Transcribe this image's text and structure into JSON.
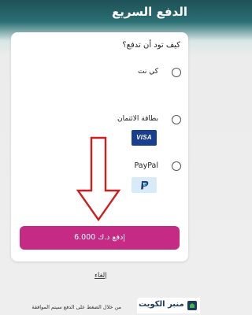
{
  "header": {
    "title": "الدفع السريع"
  },
  "payment": {
    "question": "كيف تود أن تدفع؟",
    "options": [
      {
        "label": "كي نت",
        "selected": false
      },
      {
        "label": "بطاقة الائتمان",
        "selected": false,
        "logo_icon": "visa-logo",
        "logo_text": "VISA"
      },
      {
        "label": "PayPal",
        "selected": false,
        "logo_icon": "paypal-logo"
      }
    ],
    "pay_button_label": "إدفع د.ك 6.000"
  },
  "cancel_label": "إلغاء",
  "footer": {
    "note": "من خلال الضغط على الدفع سيتم الموافقة",
    "brand": "منبر الكويت"
  },
  "colors": {
    "accent": "#c52a85",
    "header": "#2b7074",
    "arrow": "#cc1f1f",
    "visa": "#1a3f8f"
  }
}
